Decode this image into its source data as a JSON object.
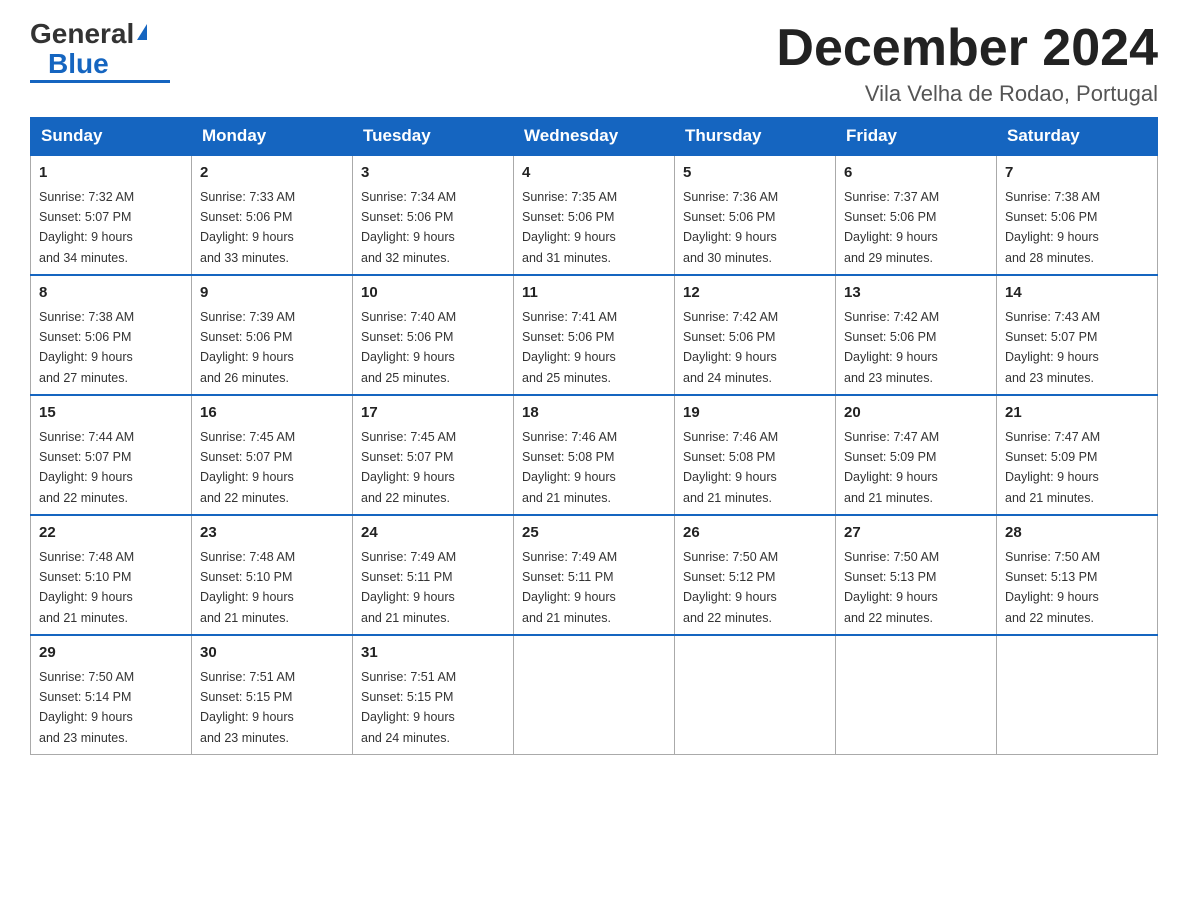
{
  "header": {
    "logo_general": "General",
    "logo_blue": "Blue",
    "month_title": "December 2024",
    "location": "Vila Velha de Rodao, Portugal"
  },
  "days_of_week": [
    "Sunday",
    "Monday",
    "Tuesday",
    "Wednesday",
    "Thursday",
    "Friday",
    "Saturday"
  ],
  "weeks": [
    [
      {
        "day": "1",
        "sunrise": "7:32 AM",
        "sunset": "5:07 PM",
        "daylight": "9 hours and 34 minutes."
      },
      {
        "day": "2",
        "sunrise": "7:33 AM",
        "sunset": "5:06 PM",
        "daylight": "9 hours and 33 minutes."
      },
      {
        "day": "3",
        "sunrise": "7:34 AM",
        "sunset": "5:06 PM",
        "daylight": "9 hours and 32 minutes."
      },
      {
        "day": "4",
        "sunrise": "7:35 AM",
        "sunset": "5:06 PM",
        "daylight": "9 hours and 31 minutes."
      },
      {
        "day": "5",
        "sunrise": "7:36 AM",
        "sunset": "5:06 PM",
        "daylight": "9 hours and 30 minutes."
      },
      {
        "day": "6",
        "sunrise": "7:37 AM",
        "sunset": "5:06 PM",
        "daylight": "9 hours and 29 minutes."
      },
      {
        "day": "7",
        "sunrise": "7:38 AM",
        "sunset": "5:06 PM",
        "daylight": "9 hours and 28 minutes."
      }
    ],
    [
      {
        "day": "8",
        "sunrise": "7:38 AM",
        "sunset": "5:06 PM",
        "daylight": "9 hours and 27 minutes."
      },
      {
        "day": "9",
        "sunrise": "7:39 AM",
        "sunset": "5:06 PM",
        "daylight": "9 hours and 26 minutes."
      },
      {
        "day": "10",
        "sunrise": "7:40 AM",
        "sunset": "5:06 PM",
        "daylight": "9 hours and 25 minutes."
      },
      {
        "day": "11",
        "sunrise": "7:41 AM",
        "sunset": "5:06 PM",
        "daylight": "9 hours and 25 minutes."
      },
      {
        "day": "12",
        "sunrise": "7:42 AM",
        "sunset": "5:06 PM",
        "daylight": "9 hours and 24 minutes."
      },
      {
        "day": "13",
        "sunrise": "7:42 AM",
        "sunset": "5:06 PM",
        "daylight": "9 hours and 23 minutes."
      },
      {
        "day": "14",
        "sunrise": "7:43 AM",
        "sunset": "5:07 PM",
        "daylight": "9 hours and 23 minutes."
      }
    ],
    [
      {
        "day": "15",
        "sunrise": "7:44 AM",
        "sunset": "5:07 PM",
        "daylight": "9 hours and 22 minutes."
      },
      {
        "day": "16",
        "sunrise": "7:45 AM",
        "sunset": "5:07 PM",
        "daylight": "9 hours and 22 minutes."
      },
      {
        "day": "17",
        "sunrise": "7:45 AM",
        "sunset": "5:07 PM",
        "daylight": "9 hours and 22 minutes."
      },
      {
        "day": "18",
        "sunrise": "7:46 AM",
        "sunset": "5:08 PM",
        "daylight": "9 hours and 21 minutes."
      },
      {
        "day": "19",
        "sunrise": "7:46 AM",
        "sunset": "5:08 PM",
        "daylight": "9 hours and 21 minutes."
      },
      {
        "day": "20",
        "sunrise": "7:47 AM",
        "sunset": "5:09 PM",
        "daylight": "9 hours and 21 minutes."
      },
      {
        "day": "21",
        "sunrise": "7:47 AM",
        "sunset": "5:09 PM",
        "daylight": "9 hours and 21 minutes."
      }
    ],
    [
      {
        "day": "22",
        "sunrise": "7:48 AM",
        "sunset": "5:10 PM",
        "daylight": "9 hours and 21 minutes."
      },
      {
        "day": "23",
        "sunrise": "7:48 AM",
        "sunset": "5:10 PM",
        "daylight": "9 hours and 21 minutes."
      },
      {
        "day": "24",
        "sunrise": "7:49 AM",
        "sunset": "5:11 PM",
        "daylight": "9 hours and 21 minutes."
      },
      {
        "day": "25",
        "sunrise": "7:49 AM",
        "sunset": "5:11 PM",
        "daylight": "9 hours and 21 minutes."
      },
      {
        "day": "26",
        "sunrise": "7:50 AM",
        "sunset": "5:12 PM",
        "daylight": "9 hours and 22 minutes."
      },
      {
        "day": "27",
        "sunrise": "7:50 AM",
        "sunset": "5:13 PM",
        "daylight": "9 hours and 22 minutes."
      },
      {
        "day": "28",
        "sunrise": "7:50 AM",
        "sunset": "5:13 PM",
        "daylight": "9 hours and 22 minutes."
      }
    ],
    [
      {
        "day": "29",
        "sunrise": "7:50 AM",
        "sunset": "5:14 PM",
        "daylight": "9 hours and 23 minutes."
      },
      {
        "day": "30",
        "sunrise": "7:51 AM",
        "sunset": "5:15 PM",
        "daylight": "9 hours and 23 minutes."
      },
      {
        "day": "31",
        "sunrise": "7:51 AM",
        "sunset": "5:15 PM",
        "daylight": "9 hours and 24 minutes."
      },
      null,
      null,
      null,
      null
    ]
  ],
  "labels": {
    "sunrise": "Sunrise:",
    "sunset": "Sunset:",
    "daylight": "Daylight:"
  }
}
